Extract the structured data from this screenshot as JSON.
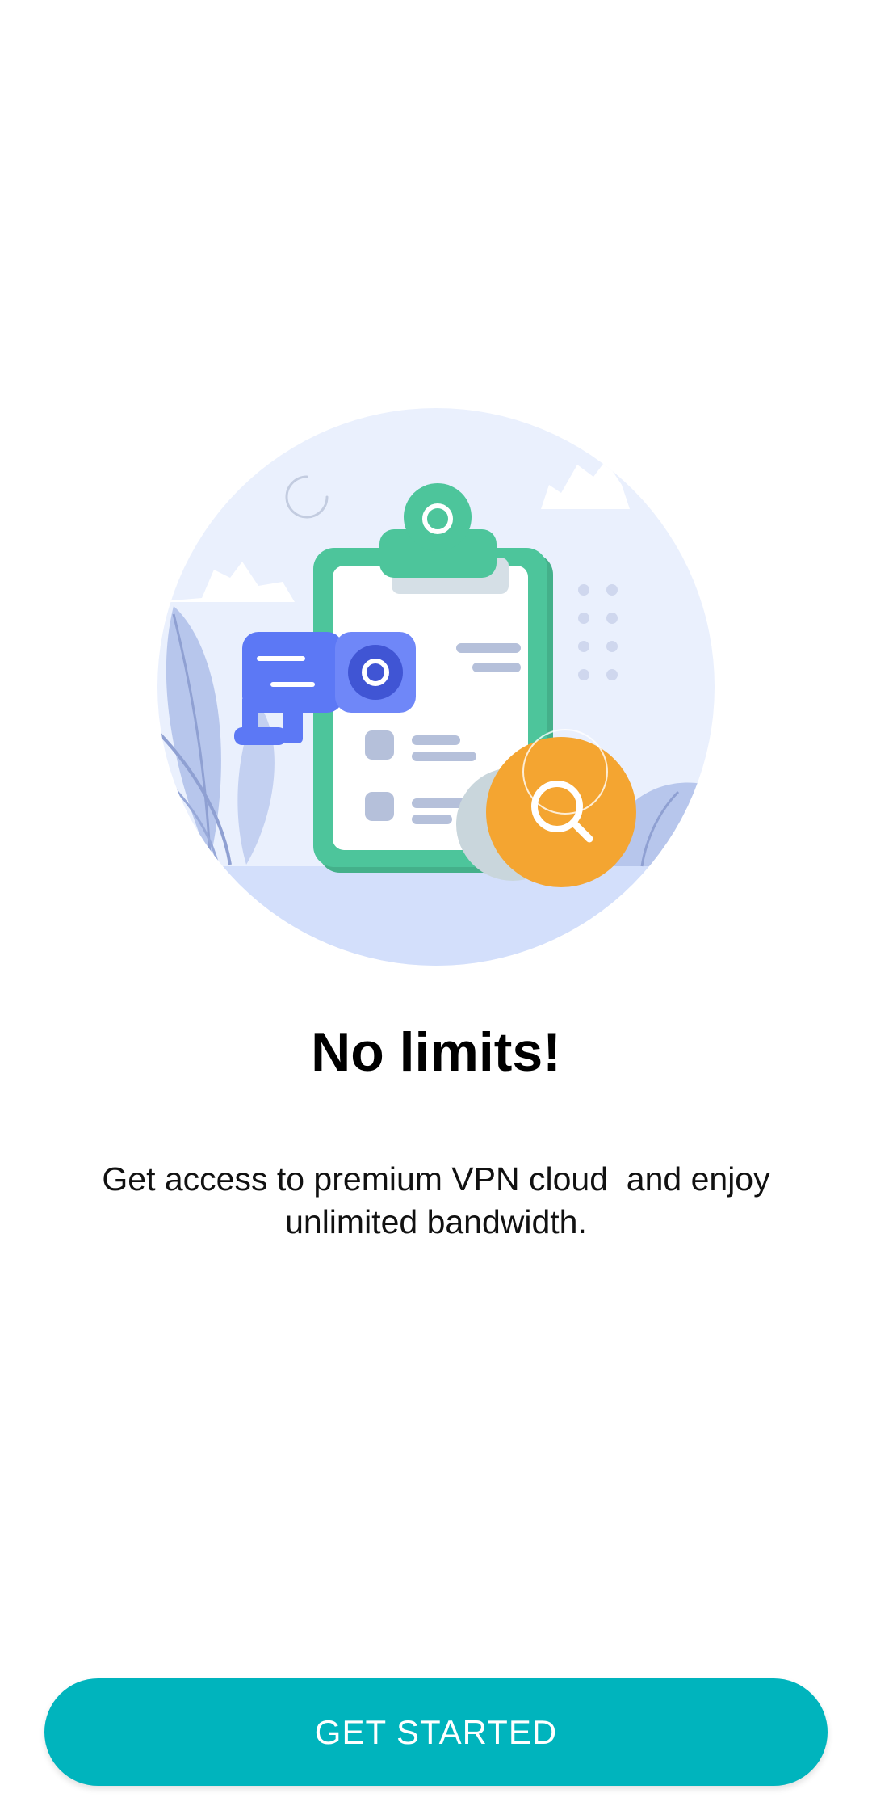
{
  "onboarding": {
    "title": "No limits!",
    "description": "Get access to premium VPN cloud  and enjoy\nunlimited bandwidth.",
    "cta_label": "GET STARTED"
  },
  "illustration": {
    "subject": "clipboard-checklist-with-camera-and-magnifier",
    "colors": {
      "circle_bg": "#eaf0fd",
      "ground": "#d3dffb",
      "clipboard": "#4dc59b",
      "camera": "#5c78f5",
      "magnifier_badge": "#f4a531",
      "muted_lines": "#b5c0da"
    }
  },
  "theme": {
    "accent": "#00b4bd",
    "text": "#000000",
    "background": "#ffffff"
  }
}
